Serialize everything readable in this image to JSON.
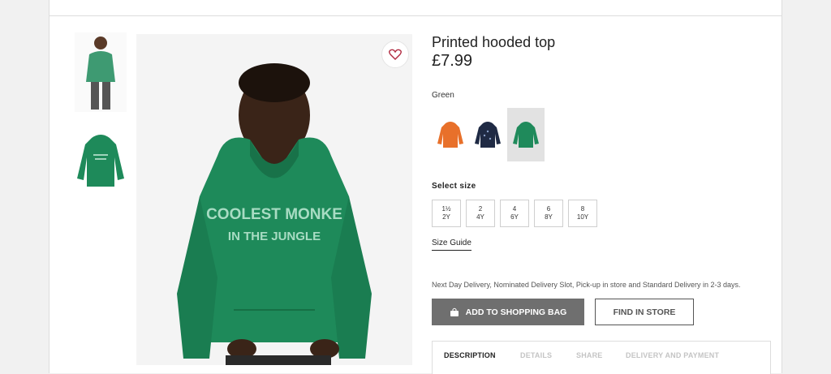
{
  "product": {
    "title": "Printed hooded top",
    "price": "£7.99",
    "favourite_icon": "heart-icon",
    "hoodie_print_line1": "COOLEST MONKE",
    "hoodie_print_line2": "IN THE JUNGLE"
  },
  "colors": {
    "label": "Green",
    "options": [
      {
        "name": "orange",
        "hex": "#e8702a"
      },
      {
        "name": "navy",
        "hex": "#1f2a44"
      },
      {
        "name": "green",
        "hex": "#1f8a5b",
        "selected": true
      }
    ],
    "hoodie_green": "#1e8a5a"
  },
  "sizes": {
    "label": "Select size",
    "options": [
      {
        "line1": "1½",
        "line2": "2Y"
      },
      {
        "line1": "2",
        "line2": "4Y"
      },
      {
        "line1": "4",
        "line2": "6Y"
      },
      {
        "line1": "6",
        "line2": "8Y"
      },
      {
        "line1": "8",
        "line2": "10Y"
      }
    ],
    "guide_label": "Size Guide"
  },
  "delivery_text": "Next Day Delivery, Nominated Delivery Slot, Pick-up in store and Standard Delivery in 2-3 days.",
  "actions": {
    "add_to_bag": "ADD TO SHOPPING BAG",
    "add_icon": "bag-icon",
    "find_in_store": "FIND IN STORE"
  },
  "tabs": [
    {
      "label": "DESCRIPTION",
      "active": true
    },
    {
      "label": "DETAILS",
      "active": false
    },
    {
      "label": "SHARE",
      "active": false
    },
    {
      "label": "DELIVERY AND PAYMENT",
      "active": false
    }
  ]
}
